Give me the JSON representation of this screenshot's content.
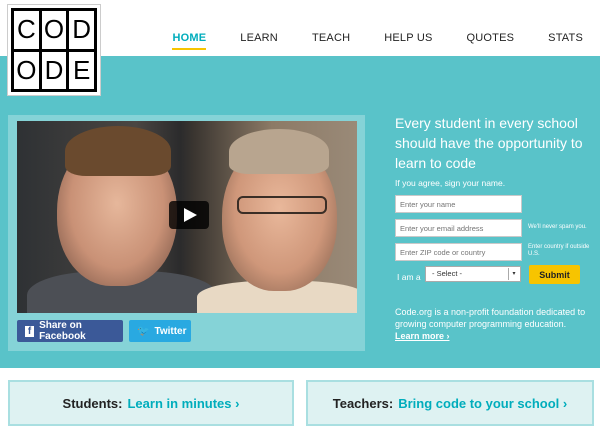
{
  "logo": {
    "letters": [
      "C",
      "O",
      "D",
      "O",
      "D",
      "E"
    ]
  },
  "nav": {
    "items": [
      "HOME",
      "LEARN",
      "TEACH",
      "HELP US",
      "QUOTES",
      "STATS"
    ],
    "active": "HOME"
  },
  "hero": {
    "headline": "Every student in every school should have the opportunity to learn to code",
    "prompt": "If you agree, sign your name.",
    "name_placeholder": "Enter your name",
    "email_placeholder": "Enter your email address",
    "zip_placeholder": "Enter ZIP code or country",
    "spam_note": "We'll never spam you.",
    "country_note": "Enter country if outside U.S.",
    "iam_label": "I am a",
    "select_value": "- Select -",
    "submit_label": "Submit",
    "about_text": "Code.org is a non-profit foundation dedicated to growing computer programming education.",
    "learn_more": "Learn more ›"
  },
  "share": {
    "facebook": "Share on Facebook",
    "twitter": "Twitter"
  },
  "cards": {
    "students_label": "Students:",
    "students_link": "Learn in minutes ›",
    "teachers_label": "Teachers:",
    "teachers_link": "Bring code to your school ›"
  },
  "colors": {
    "teal": "#59c3c9",
    "accent": "#00adbc",
    "yellow": "#f7c400",
    "facebook": "#3b5998",
    "twitter": "#29a9e1"
  }
}
